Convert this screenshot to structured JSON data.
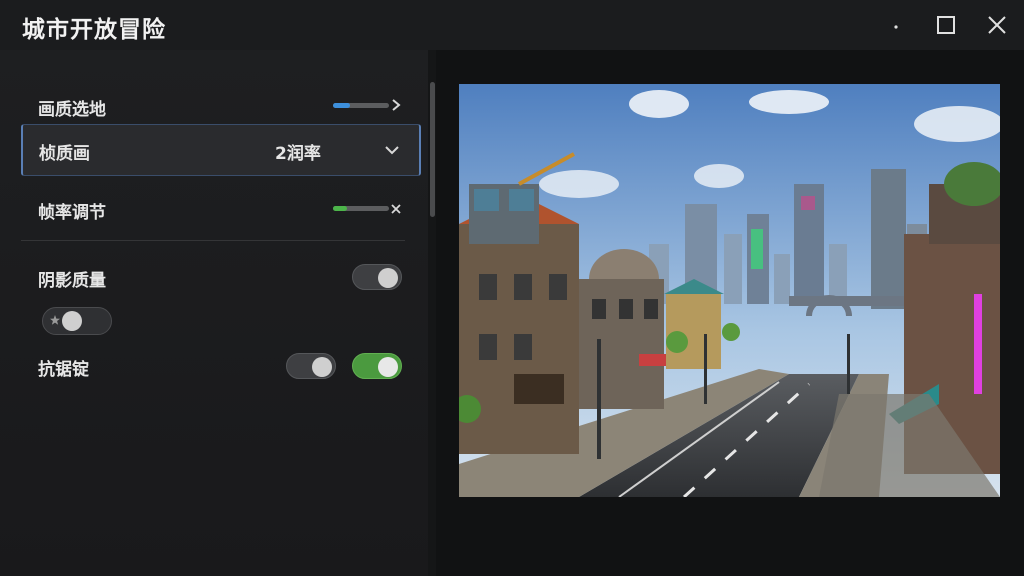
{
  "window": {
    "title": "城市开放冒险"
  },
  "settings": {
    "quality_preset": {
      "label": "画质选地",
      "level": 0.3
    },
    "texture_quality": {
      "label": "桢质画",
      "value": "2润率"
    },
    "frame_rate": {
      "label": "帧率调节",
      "level": 0.25
    },
    "shadow_quality": {
      "label": "阴影质量",
      "enabled": false
    },
    "anti_aliasing": {
      "label": "抗锯锭",
      "toggle_a": false,
      "toggle_b": true
    }
  },
  "colors": {
    "accent_blue": "#3d8fdc",
    "accent_green": "#4cb54a",
    "toggle_on": "#4b9a3f"
  },
  "icons": {
    "minimize": "minimize-icon",
    "maximize": "maximize-icon",
    "close": "close-icon",
    "chevron_right": "chevron-right-icon",
    "chevron_down": "chevron-down-icon",
    "slider_close": "x-icon",
    "star": "star-icon"
  }
}
